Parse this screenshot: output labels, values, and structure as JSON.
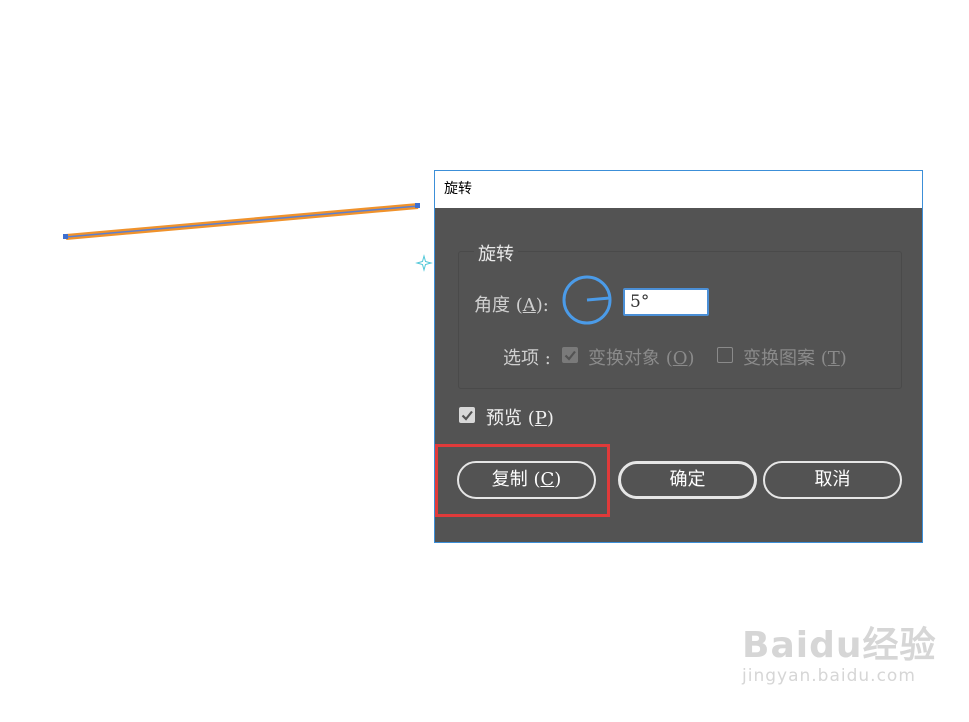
{
  "dialog": {
    "title": "旋转",
    "group_title": "旋转",
    "angle_label_prefix": "角度 (",
    "angle_label_key": "A",
    "angle_label_suffix": "):",
    "angle_value": "5°",
    "options_label": "选项 :",
    "option_objects_label_prefix": "变换对象 (",
    "option_objects_key": "O",
    "option_objects_suffix": ")",
    "option_objects_checked": true,
    "option_patterns_label_prefix": "变换图案 (",
    "option_patterns_key": "T",
    "option_patterns_suffix": ")",
    "option_patterns_checked": false,
    "preview_label_prefix": "预览 (",
    "preview_key": "P",
    "preview_suffix": ")",
    "preview_checked": true,
    "buttons": {
      "copy_prefix": "复制 (",
      "copy_key": "C",
      "copy_suffix": ")",
      "ok": "确定",
      "cancel": "取消"
    }
  },
  "colors": {
    "line_stroke": "#f0922b",
    "line_path": "#5b7fd0",
    "dialog_bg": "#535353",
    "accent": "#4b8fd6",
    "highlight": "#e03a3a"
  },
  "watermark": {
    "logo": "Baidu经验",
    "url": "jingyan.baidu.com"
  }
}
